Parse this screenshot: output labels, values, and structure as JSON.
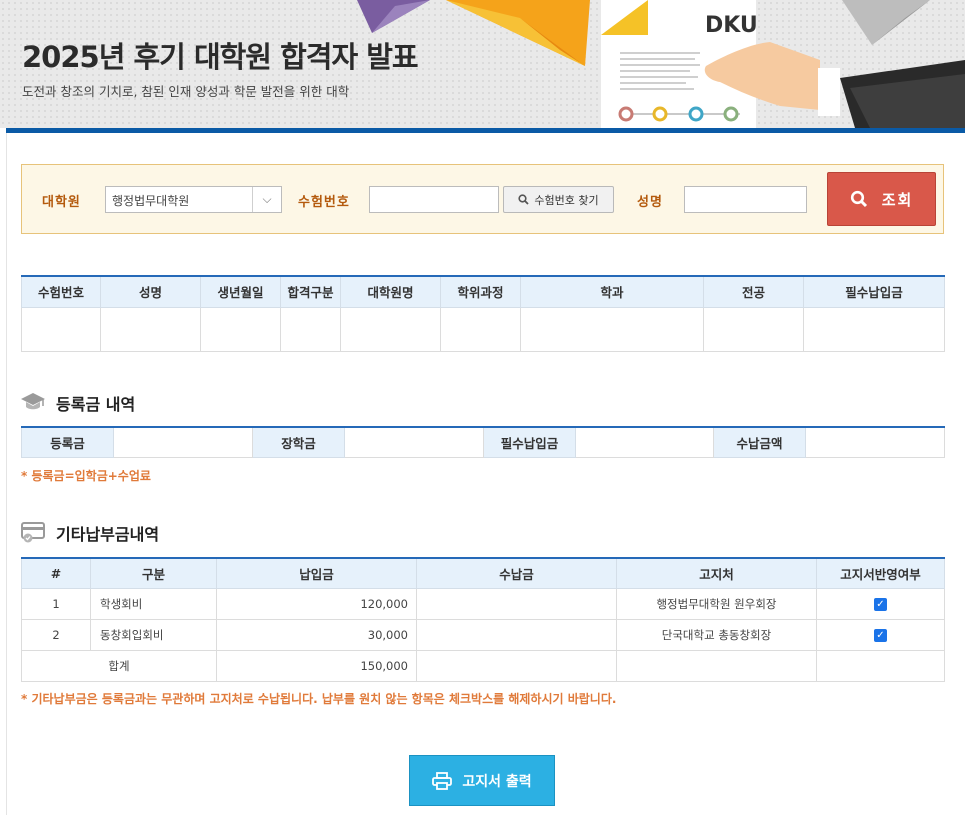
{
  "header": {
    "title": "2025년 후기 대학원 합격자 발표",
    "subtitle": "도전과 창조의 기치로, 참된 인재 양성과 학문 발전을 위한 대학",
    "logo_text": "DKU"
  },
  "search": {
    "grad_school_label": "대학원",
    "grad_school_value": "행정법무대학원",
    "exam_no_label": "수험번호",
    "exam_no_value": "",
    "find_exam_no_button": "수험번호 찾기",
    "name_label": "성명",
    "name_value": "",
    "query_button": "조회"
  },
  "result_table": {
    "headers": [
      "수험번호",
      "성명",
      "생년월일",
      "합격구분",
      "대학원명",
      "학위과정",
      "학과",
      "전공",
      "필수납입금"
    ],
    "rows": []
  },
  "tuition": {
    "title": "등록금 내역",
    "labels": [
      "등록금",
      "장학금",
      "필수납입금",
      "수납금액"
    ],
    "values": [
      "",
      "",
      "",
      ""
    ],
    "note": "* 등록금=입학금+수업료"
  },
  "other_fees": {
    "title": "기타납부금내역",
    "headers": [
      "#",
      "구분",
      "납입금",
      "수납금",
      "고지처",
      "고지서반영여부"
    ],
    "rows": [
      {
        "no": "1",
        "category": "학생회비",
        "amount": "120,000",
        "received": "",
        "notifier": "행정법무대학원 원우회장",
        "checked": true
      },
      {
        "no": "2",
        "category": "동창회입회비",
        "amount": "30,000",
        "received": "",
        "notifier": "단국대학교 총동창회장",
        "checked": true
      }
    ],
    "total_label": "합계",
    "total_amount": "150,000",
    "note": "* 기타납부금은 등록금과는 무관하며 고지처로 수납됩니다. 납부를 원치 않는 항목은 체크박스를 해제하시기 바랍니다."
  },
  "print_button": "고지서 출력",
  "colors": {
    "accent_blue": "#0a5aa6",
    "query_red": "#d9584a",
    "print_cyan": "#2cb0e3",
    "label_orange": "#b45a0d",
    "note_orange": "#e07a3a"
  }
}
